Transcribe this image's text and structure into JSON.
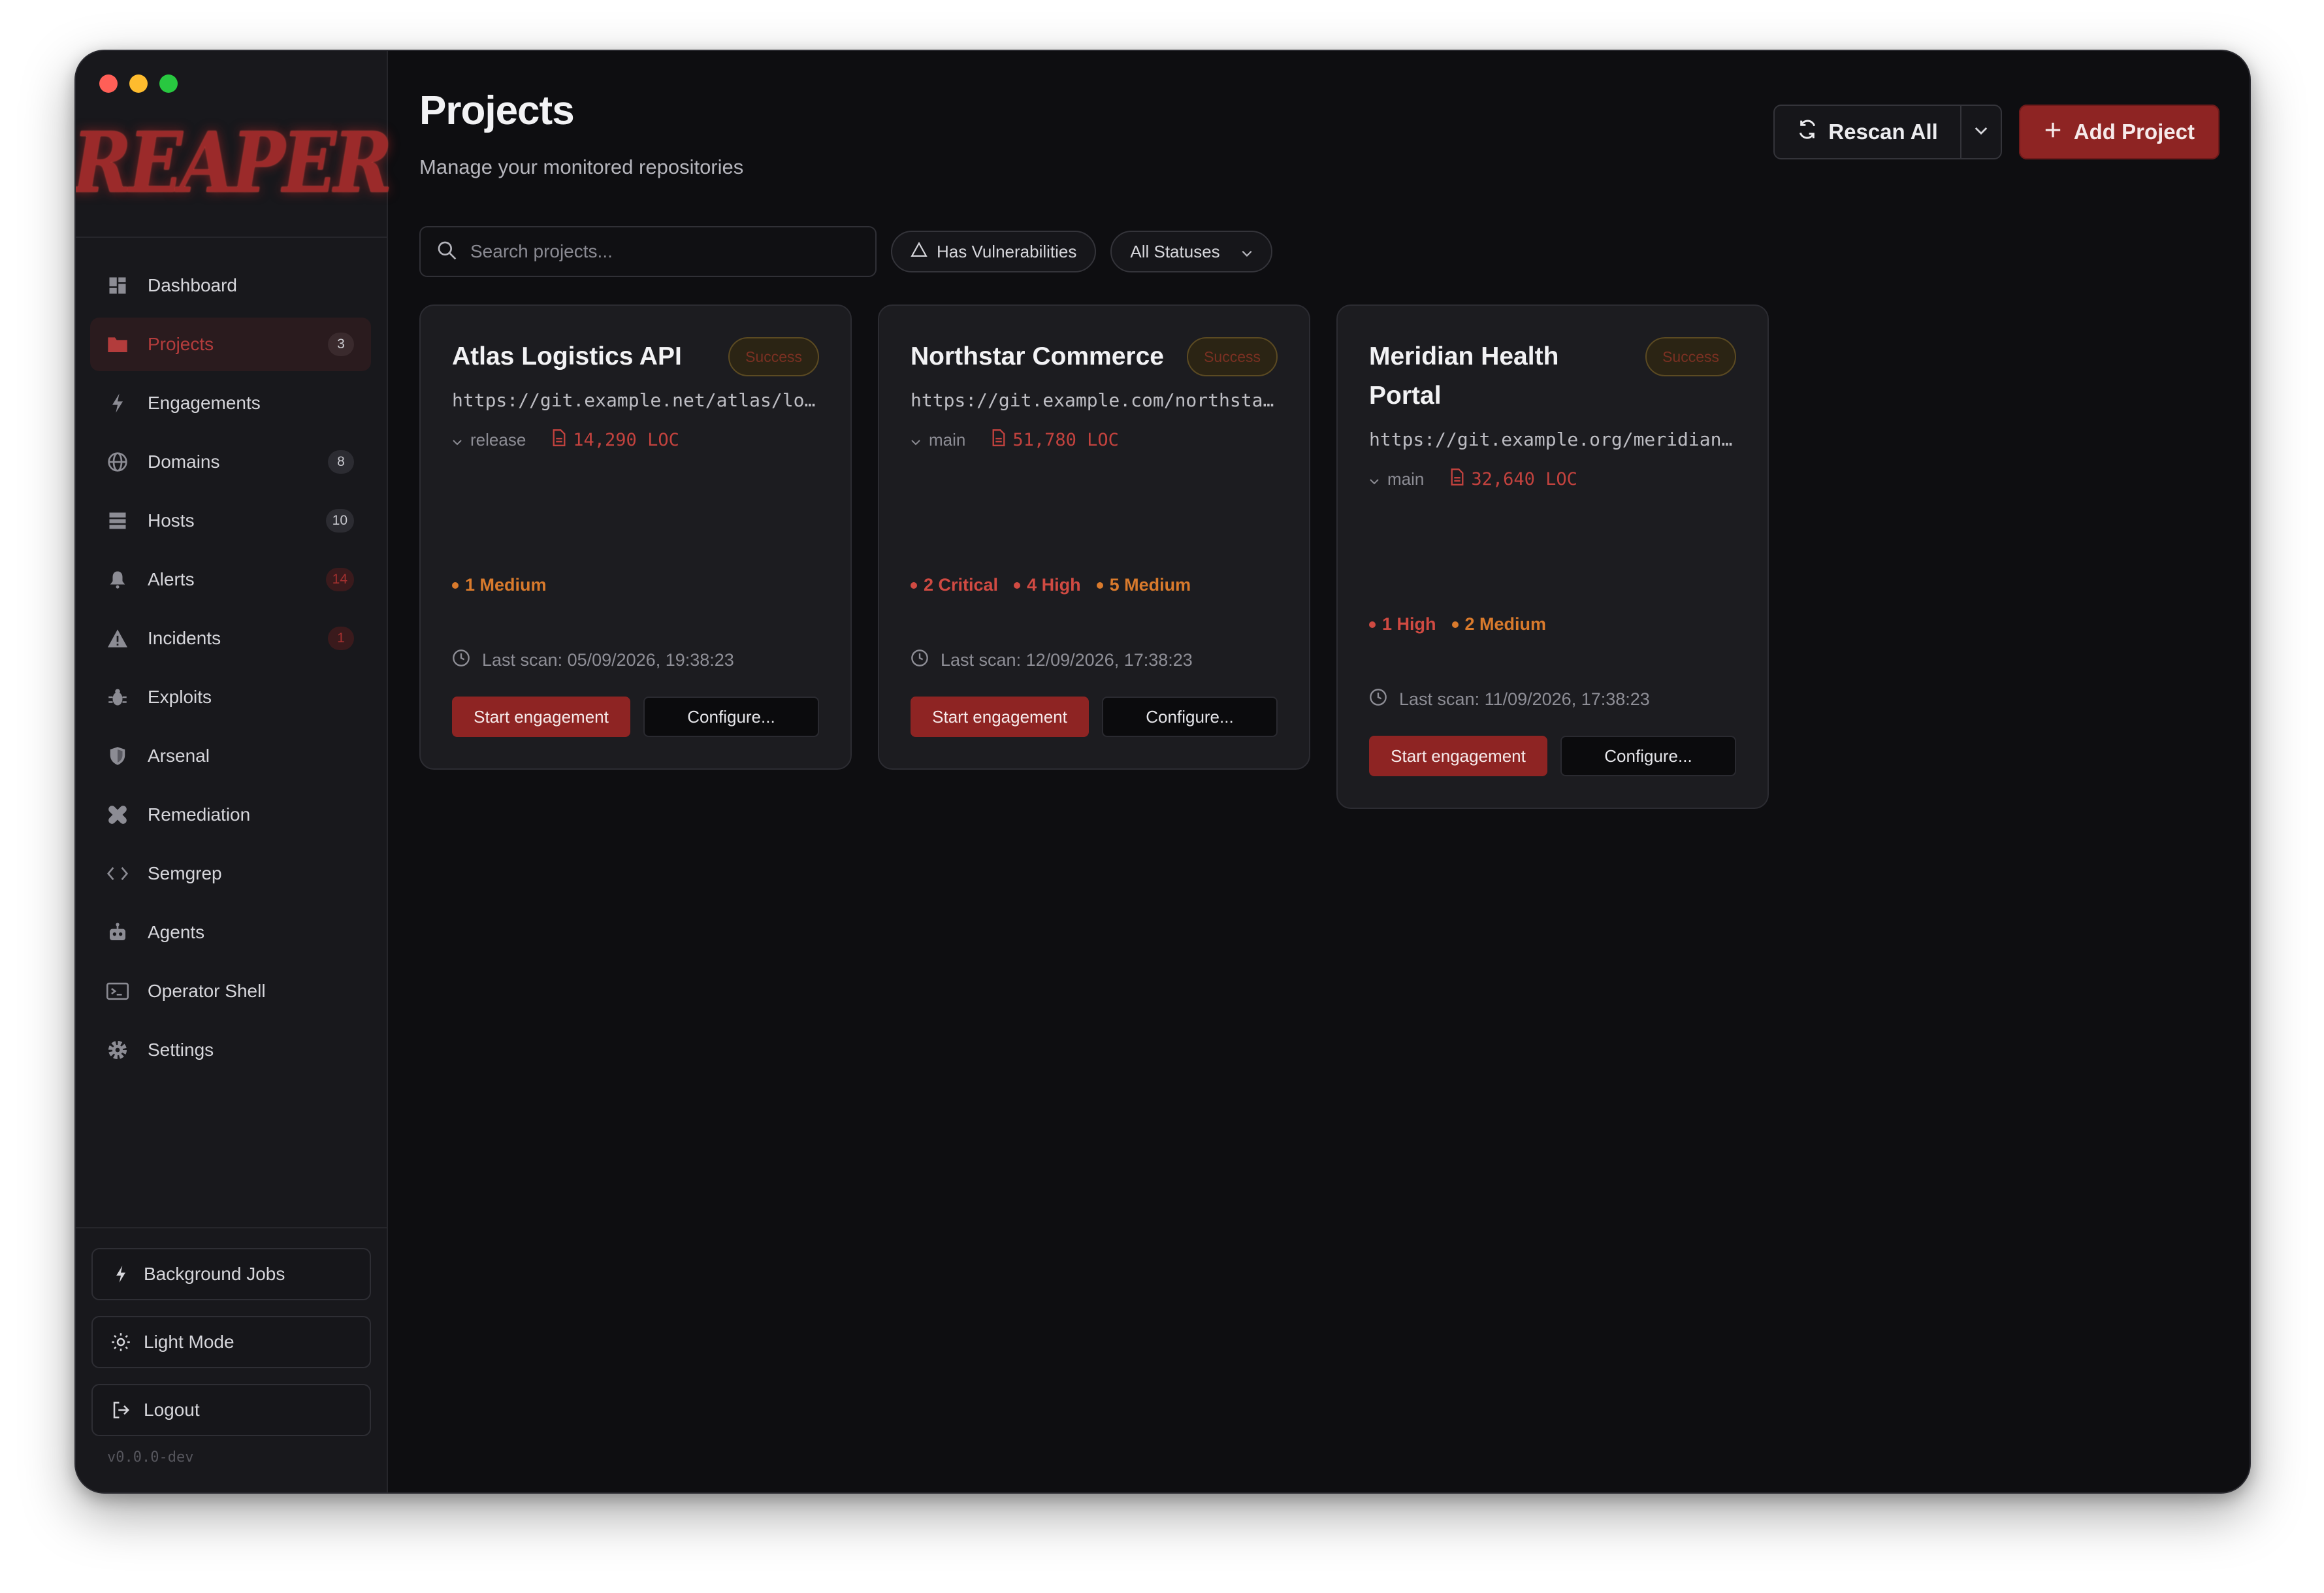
{
  "app": {
    "logo_text": "REAPER",
    "version": "v0.0.0-dev"
  },
  "sidebar": {
    "items": [
      {
        "label": "Dashboard",
        "icon": "dashboard-icon",
        "badge": ""
      },
      {
        "label": "Projects",
        "icon": "folder-icon",
        "badge": "3",
        "active": true
      },
      {
        "label": "Engagements",
        "icon": "bolt-icon",
        "badge": ""
      },
      {
        "label": "Domains",
        "icon": "globe-icon",
        "badge": "8"
      },
      {
        "label": "Hosts",
        "icon": "server-icon",
        "badge": "10"
      },
      {
        "label": "Alerts",
        "icon": "bell-icon",
        "badge": "14"
      },
      {
        "label": "Incidents",
        "icon": "warning-icon",
        "badge": "1"
      },
      {
        "label": "Exploits",
        "icon": "bug-icon",
        "badge": ""
      },
      {
        "label": "Arsenal",
        "icon": "shield-icon",
        "badge": ""
      },
      {
        "label": "Remediation",
        "icon": "bandage-icon",
        "badge": ""
      },
      {
        "label": "Semgrep",
        "icon": "code-icon",
        "badge": ""
      },
      {
        "label": "Agents",
        "icon": "robot-icon",
        "badge": ""
      },
      {
        "label": "Operator Shell",
        "icon": "terminal-icon",
        "badge": ""
      },
      {
        "label": "Settings",
        "icon": "gear-icon",
        "badge": ""
      }
    ],
    "bottom": {
      "background_jobs": "Background Jobs",
      "light_mode": "Light Mode",
      "logout": "Logout"
    }
  },
  "header": {
    "title": "Projects",
    "subtitle": "Manage your monitored repositories",
    "rescan_label": "Rescan All",
    "add_label": "Add Project"
  },
  "filters": {
    "search_placeholder": "Search projects...",
    "vuln_chip": "Has Vulnerabilities",
    "status_select": "All Statuses"
  },
  "cards": [
    {
      "title": "Atlas Logistics API",
      "status": "Success",
      "url": "https://git.example.net/atlas/logistics-api",
      "branch": "release",
      "loc": "14,290 LOC",
      "vulns": [
        {
          "label": "1 Medium",
          "severity": "medium"
        }
      ],
      "last_scan": "Last scan: 05/09/2026, 19:38:23",
      "start_label": "Start engagement",
      "config_label": "Configure..."
    },
    {
      "title": "Northstar Commerce",
      "status": "Success",
      "url": "https://git.example.com/northstar/commerce",
      "branch": "main",
      "loc": "51,780 LOC",
      "vulns": [
        {
          "label": "2 Critical",
          "severity": "critical"
        },
        {
          "label": "4 High",
          "severity": "high"
        },
        {
          "label": "5 Medium",
          "severity": "medium"
        }
      ],
      "last_scan": "Last scan: 12/09/2026, 17:38:23",
      "start_label": "Start engagement",
      "config_label": "Configure..."
    },
    {
      "title": "Meridian Health Portal",
      "status": "Success",
      "url": "https://git.example.org/meridian/health-portal",
      "branch": "main",
      "loc": "32,640 LOC",
      "vulns": [
        {
          "label": "1 High",
          "severity": "high"
        },
        {
          "label": "2 Medium",
          "severity": "medium"
        }
      ],
      "last_scan": "Last scan: 11/09/2026, 17:38:23",
      "start_label": "Start engagement",
      "config_label": "Configure..."
    }
  ],
  "colors": {
    "accent": "#8e2423",
    "critical": "#d04a42",
    "medium": "#d97a2c",
    "background": "#0e0e11"
  }
}
